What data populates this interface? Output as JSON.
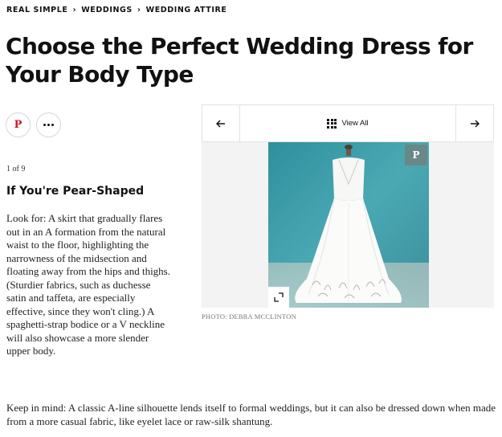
{
  "breadcrumb": {
    "items": [
      "REAL SIMPLE",
      "WEDDINGS",
      "WEDDING ATTIRE"
    ]
  },
  "article": {
    "title": "Choose the Perfect Wedding Dress for Your Body Type"
  },
  "share": {
    "pinterest_icon": "pinterest-icon",
    "more_icon": "more-dots-icon"
  },
  "slide": {
    "counter": "1 of 9",
    "heading": "If You're Pear-Shaped",
    "body": "Look for: A skirt that gradually flares out in an A formation from the natural waist to the floor, highlighting the narrowness of the midsection and floating away from the hips and thighs. (Sturdier fabrics, such as duchesse satin and taffeta, are especially effective, since they won't cling.) A spaghetti-strap bodice or a V neckline will also showcase a more slender upper body.",
    "keep_in_mind": "Keep in mind: A classic A-line silhouette lends itself to formal weddings, but it can also be dressed down when made from a more casual fabric, like eyelet lace or raw-silk shantung."
  },
  "gallery": {
    "view_all_label": "View All",
    "prev_icon": "arrow-left-icon",
    "next_icon": "arrow-right-icon",
    "photo_credit": "PHOTO: DEBRA MCCLINTON"
  },
  "colors": {
    "pinterest_red": "#d11a2a",
    "photo_background": "#3b9aa6"
  }
}
